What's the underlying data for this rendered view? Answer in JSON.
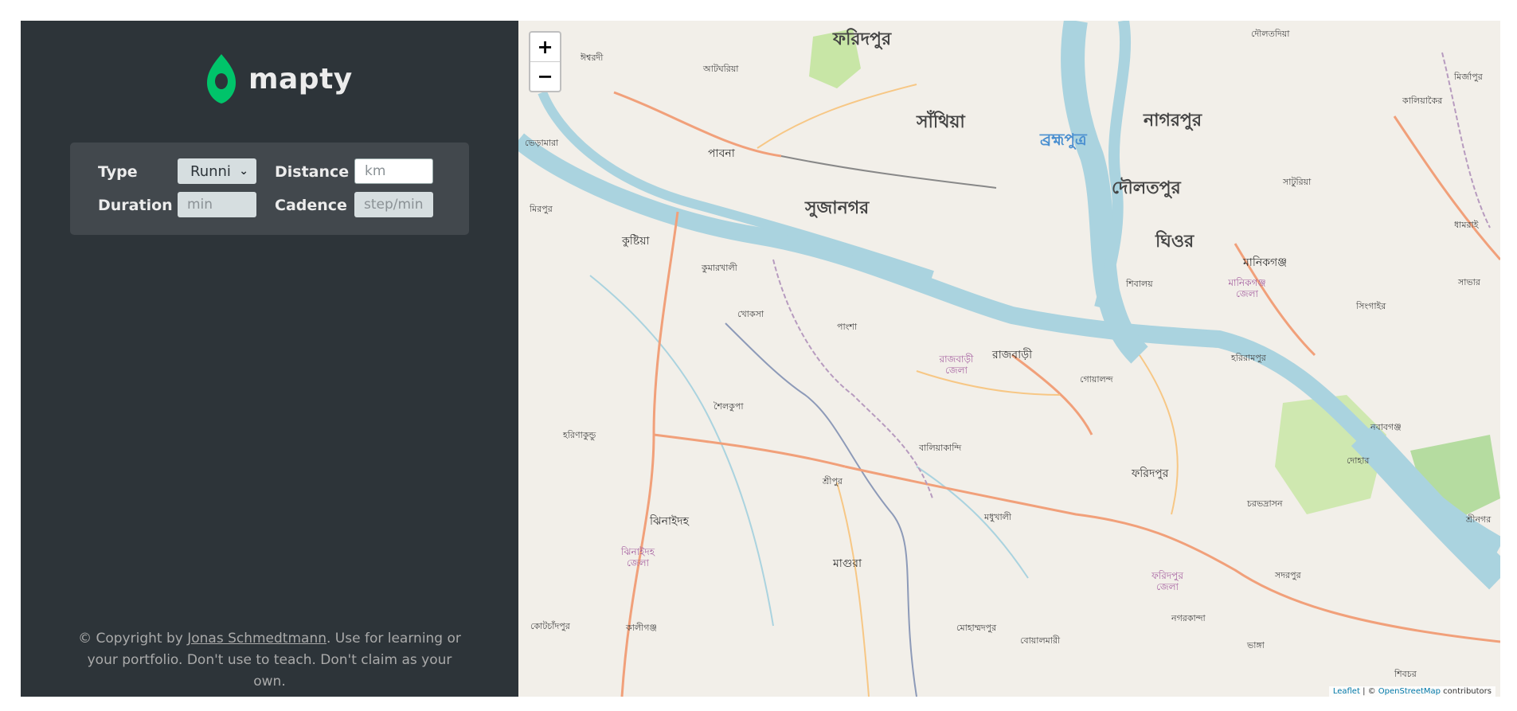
{
  "sidebar": {
    "logo_text": "mapty",
    "logo_icon": "map-pin-icon",
    "brand_color": "#00c46a",
    "form": {
      "type_label": "Type",
      "type_value": "Runni",
      "distance_label": "Distance",
      "distance_placeholder": "km",
      "duration_label": "Duration",
      "duration_placeholder": "min",
      "cadence_label": "Cadence",
      "cadence_placeholder": "step/min"
    },
    "copyright": {
      "prefix": "© Copyright by ",
      "author": "Jonas Schmedtmann",
      "suffix": ". Use for learning or your portfolio. Don't use to teach. Don't claim as your own."
    }
  },
  "map": {
    "zoom_in": "+",
    "zoom_out": "−",
    "attribution": {
      "leaflet": "Leaflet",
      "separator": " | © ",
      "osm": "OpenStreetMap",
      "suffix": " contributors"
    },
    "labels": {
      "faridpur_top": "ফরিদপুর",
      "sathia": "সাঁথিয়া",
      "nagarpur": "নাগরপুর",
      "brahmaputra": "ব্রহ্মপুত্র",
      "daulatpur": "দৌলতপুর",
      "sujanagar": "সুজানগর",
      "ghior": "ঘিওর",
      "pabna": "পাবনা",
      "kushtia": "কুষ্টিয়া",
      "manikganj": "মানিকগঞ্জ",
      "rajbari": "রাজবাড়ী",
      "faridpur": "ফরিদপুর",
      "jhenaidah": "ঝিনাইদহ",
      "magura": "মাগুরা",
      "ishwardi": "ঈশ্বরদী",
      "atgharia": "আটঘরিয়া",
      "bheramara": "ভেড়ামারা",
      "mirpur": "মিরপুর",
      "kumarkhali": "কুমারখালী",
      "khoksa": "খোকসা",
      "pangsha": "পাংশা",
      "shailkupa": "শৈলকুপা",
      "harinakunda": "হরিণাকুন্ডু",
      "baliakandi": "বালিয়াকান্দি",
      "sreepur": "শ্রীপুর",
      "madhukhali": "মধুখালী",
      "goalanda": "গোয়ালন্দ",
      "shibalaya": "শিবালয়",
      "harirampur": "হরিরামপুর",
      "saturia": "সাটুরিয়া",
      "singair": "সিংগাইর",
      "nawabganj": "নবাবগঞ্জ",
      "dohar": "দোহার",
      "charbhadrasan": "চরভদ্রাসন",
      "sadarpur": "সদরপুর",
      "nagarkanda": "নগরকান্দা",
      "bhanga": "ভাঙ্গা",
      "mohammadpur": "মোহাম্মদপুর",
      "boalmari": "বোয়ালমারী",
      "kotchandpur": "কোটচাঁদপুর",
      "kaliganj": "কালীগঞ্জ",
      "shibchar": "শিবচর",
      "sreenagar": "শ্রীনগর",
      "mirzapur": "মির্জাপুর",
      "kaliakair": "কালিয়াকৈর",
      "dhamrai": "ধামরাই",
      "savar": "সাভার",
      "daulatdia": "দৌলতদিয়া",
      "rajbari_district": "রাজবাড়ী জেলা",
      "faridpur_district": "ফরিদপুর জেলা",
      "jhenaidah_district": "ঝিনাইদহ জেলা",
      "manikganj_district": "মানিকগঞ্জ জেলা"
    }
  }
}
